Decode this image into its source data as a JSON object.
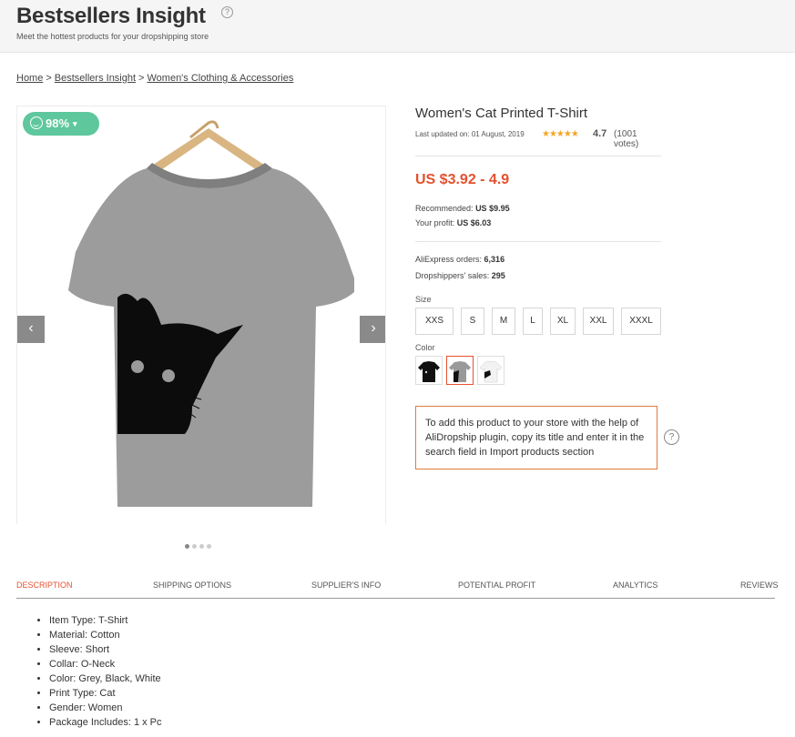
{
  "header": {
    "title": "Bestsellers Insight",
    "help_glyph": "?",
    "subtitle": "Meet the hottest products for your dropshipping store"
  },
  "breadcrumb": {
    "items": [
      "Home",
      "Bestsellers Insight",
      "Women's Clothing & Accessories"
    ],
    "separator": ">"
  },
  "gallery": {
    "badge_percent": "98%",
    "prev_glyph": "‹",
    "next_glyph": "›",
    "slide_count": 4,
    "active_slide": 0
  },
  "product": {
    "title": "Women's Cat Printed T-Shirt",
    "last_updated": "Last updated on: 01 August, 2019",
    "stars_glyph": "★★★★★",
    "rating": "4.7",
    "votes": "(1001 votes)",
    "price": "US $3.92 - 4.9",
    "recommended_label": "Recommended:",
    "recommended_value": "US $9.95",
    "profit_label": "Your profit:",
    "profit_value": "US $6.03",
    "orders_label": "AliExpress orders:",
    "orders_value": "6,316",
    "sales_label": "Dropshippers' sales:",
    "sales_value": "295",
    "size_label": "Size",
    "sizes": [
      "XXS",
      "S",
      "M",
      "L",
      "XL",
      "XXL",
      "XXXL"
    ],
    "color_label": "Color",
    "colors": [
      "black",
      "grey",
      "white"
    ],
    "selected_color": "grey"
  },
  "notice": {
    "text": "To add this product to your store with the help of AliDropship plugin, copy its title and enter it in the search field in Import products section",
    "help_glyph": "?"
  },
  "tabs": [
    {
      "label": "DESCRIPTION",
      "active": true
    },
    {
      "label": "SHIPPING OPTIONS",
      "active": false
    },
    {
      "label": "SUPPLIER'S INFO",
      "active": false
    },
    {
      "label": "POTENTIAL PROFIT",
      "active": false
    },
    {
      "label": "ANALYTICS",
      "active": false
    },
    {
      "label": "REVIEWS",
      "active": false
    }
  ],
  "description": [
    "Item Type: T-Shirt",
    "Material: Cotton",
    "Sleeve: Short",
    "Collar: O-Neck",
    "Color: Grey, Black, White",
    "Print Type: Cat",
    "Gender: Women",
    "Package Includes: 1 x Pc"
  ],
  "colors": {
    "accent": "#e5512e",
    "badge": "#5ec79b",
    "notice_border": "#e07b3c",
    "header_bg": "#f5f5f5",
    "star": "#f5a623"
  }
}
